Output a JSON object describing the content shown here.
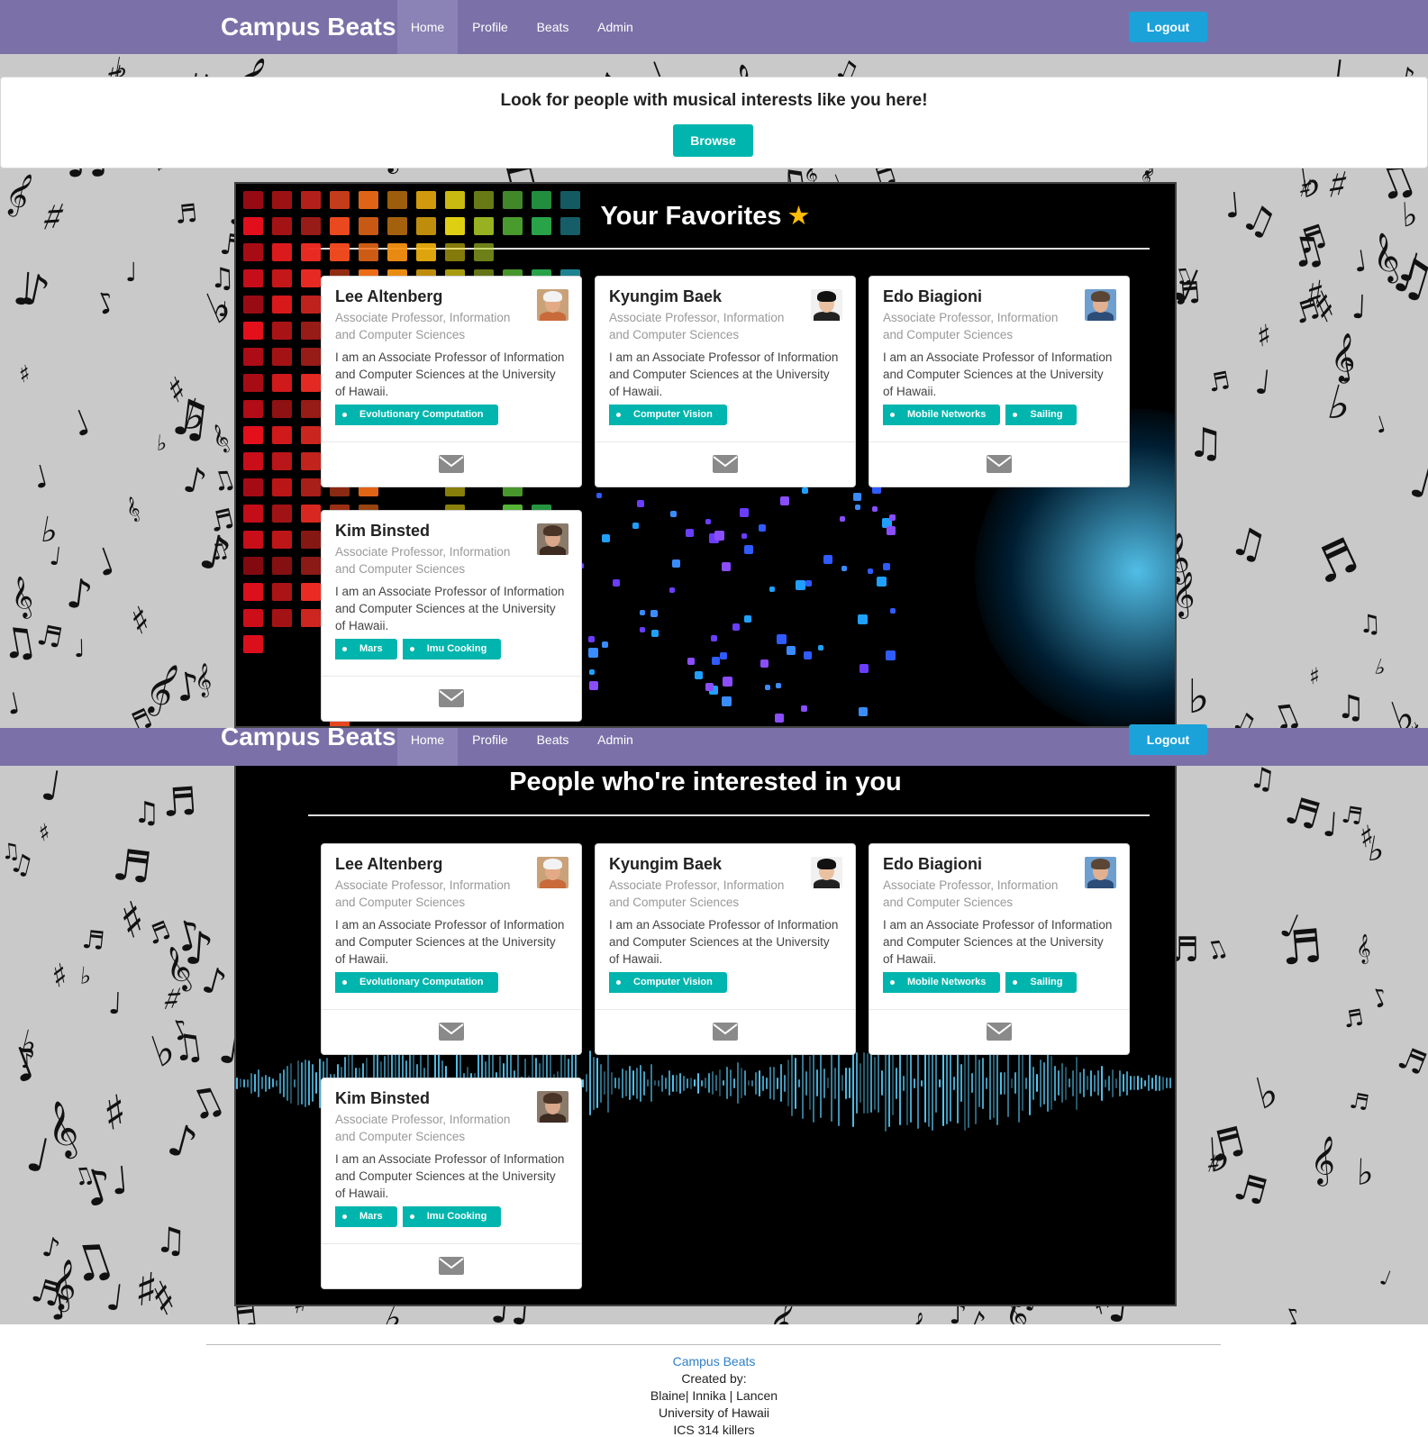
{
  "nav_top": {
    "brand": "Campus Beats",
    "items": [
      {
        "label": "Home",
        "active": true
      },
      {
        "label": "Profile",
        "active": false
      },
      {
        "label": "Beats",
        "active": false
      },
      {
        "label": "Admin",
        "active": false
      }
    ],
    "logout_label": "Logout"
  },
  "nav_second": {
    "brand": "Campus Beats",
    "items": [
      {
        "label": "Home",
        "active": true
      },
      {
        "label": "Profile",
        "active": false
      },
      {
        "label": "Beats",
        "active": false
      },
      {
        "label": "Admin",
        "active": false
      }
    ],
    "logout_label": "Logout"
  },
  "browse": {
    "message": "Look for people with musical interests like you here!",
    "button_label": "Browse"
  },
  "favorites": {
    "title": "Your Favorites",
    "title_icon": "star-icon",
    "cards": [
      {
        "name": "Lee Altenberg",
        "title_line1": "Associate Professor, Information",
        "title_line2": "and Computer Sciences",
        "desc1": "I am an Associate Professor of Information",
        "desc2": "and Computer Sciences at the University",
        "desc3": "of Hawaii.",
        "tags": [
          "Evolutionary Computation"
        ],
        "mail_icon": "envelope-icon"
      },
      {
        "name": "Kyungim Baek",
        "title_line1": "Associate Professor, Information",
        "title_line2": "and Computer Sciences",
        "desc1": "I am an Associate Professor of Information",
        "desc2": "and Computer Sciences at the University",
        "desc3": "of Hawaii.",
        "tags": [
          "Computer Vision"
        ],
        "mail_icon": "envelope-icon"
      },
      {
        "name": "Edo Biagioni",
        "title_line1": "Associate Professor, Information",
        "title_line2": "and Computer Sciences",
        "desc1": "I am an Associate Professor of Information",
        "desc2": "and Computer Sciences at the University",
        "desc3": "of Hawaii.",
        "tags": [
          "Mobile Networks",
          "Sailing"
        ],
        "mail_icon": "envelope-icon"
      },
      {
        "name": "Kim Binsted",
        "title_line1": "Associate Professor, Information",
        "title_line2": "and Computer Sciences",
        "desc1": "I am an Associate Professor of Information",
        "desc2": "and Computer Sciences at the University",
        "desc3": "of Hawaii.",
        "tags": [
          "Mars",
          "Imu Cooking"
        ],
        "mail_icon": "envelope-icon"
      }
    ]
  },
  "interested": {
    "title": "People who're interested in you",
    "cards": [
      {
        "name": "Lee Altenberg",
        "title_line1": "Associate Professor, Information",
        "title_line2": "and Computer Sciences",
        "desc1": "I am an Associate Professor of Information",
        "desc2": "and Computer Sciences at the University",
        "desc3": "of Hawaii.",
        "tags": [
          "Evolutionary Computation"
        ],
        "mail_icon": "envelope-icon"
      },
      {
        "name": "Kyungim Baek",
        "title_line1": "Associate Professor, Information",
        "title_line2": "and Computer Sciences",
        "desc1": "I am an Associate Professor of Information",
        "desc2": "and Computer Sciences at the University",
        "desc3": "of Hawaii.",
        "tags": [
          "Computer Vision"
        ],
        "mail_icon": "envelope-icon"
      },
      {
        "name": "Edo Biagioni",
        "title_line1": "Associate Professor, Information",
        "title_line2": "and Computer Sciences",
        "desc1": "I am an Associate Professor of Information",
        "desc2": "and Computer Sciences at the University",
        "desc3": "of Hawaii.",
        "tags": [
          "Mobile Networks",
          "Sailing"
        ],
        "mail_icon": "envelope-icon"
      },
      {
        "name": "Kim Binsted",
        "title_line1": "Associate Professor, Information",
        "title_line2": "and Computer Sciences",
        "desc1": "I am an Associate Professor of Information",
        "desc2": "and Computer Sciences at the University",
        "desc3": "of Hawaii.",
        "tags": [
          "Mars",
          "Imu Cooking"
        ],
        "mail_icon": "envelope-icon"
      }
    ]
  },
  "footer": {
    "brand": "Campus Beats",
    "line1": "Created by:",
    "line2": "Blaine| Innika | Lancen",
    "line3": "University of Hawaii",
    "line4": "ICS 314 killers"
  },
  "colors": {
    "navbar": "#7b71a8",
    "logout": "#1ba2d9",
    "teal": "#00b5ad",
    "star": "#fbbd08",
    "footer_link": "#2f80c8"
  }
}
